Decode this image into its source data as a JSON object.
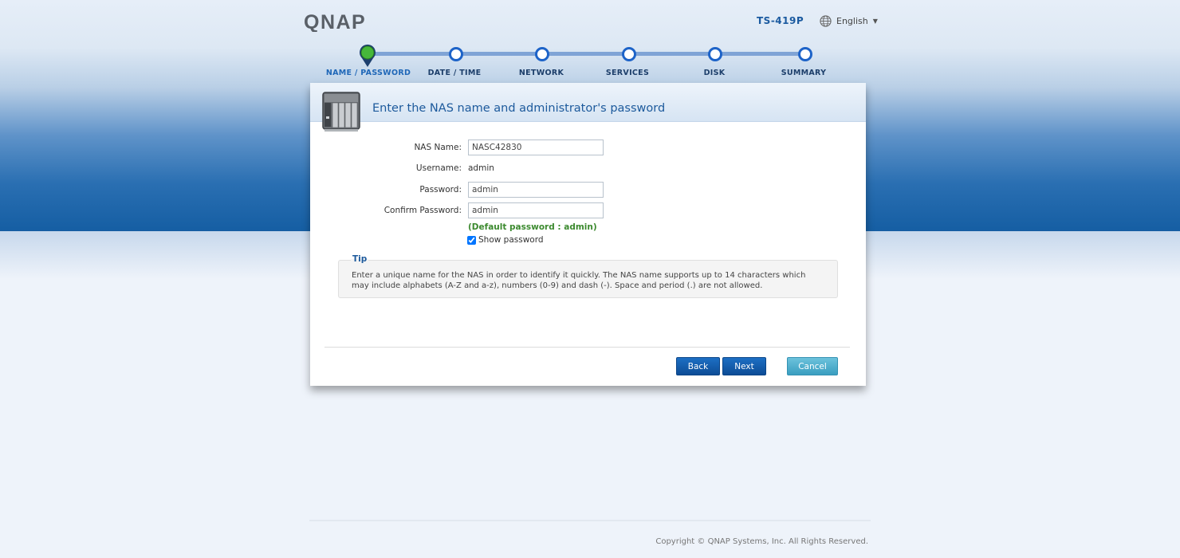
{
  "brand": {
    "logo": "QNAP",
    "model": "TS-419P"
  },
  "language": {
    "label": "English"
  },
  "steps": [
    {
      "label": "NAME / PASSWORD",
      "active": true
    },
    {
      "label": "DATE / TIME",
      "active": false
    },
    {
      "label": "NETWORK",
      "active": false
    },
    {
      "label": "SERVICES",
      "active": false
    },
    {
      "label": "DISK",
      "active": false
    },
    {
      "label": "SUMMARY",
      "active": false
    }
  ],
  "panel": {
    "title": "Enter the NAS name and administrator's password",
    "form": {
      "nas_name_label": "NAS Name:",
      "nas_name_value": "NASC42830",
      "username_label": "Username:",
      "username_value": "admin",
      "password_label": "Password:",
      "password_value": "admin",
      "confirm_label": "Confirm Password:",
      "confirm_value": "admin",
      "default_note": "(Default password : admin)",
      "show_password_label": "Show password",
      "show_password_checked": true
    },
    "tip": {
      "title": "Tip",
      "text": "Enter a unique name for the NAS in order to identify it quickly. The NAS name supports up to 14 characters which may include alphabets (A-Z and a-z), numbers (0-9) and dash (-). Space and period (.) are not allowed."
    },
    "buttons": {
      "back": "Back",
      "next": "Next",
      "cancel": "Cancel"
    }
  },
  "footer": {
    "copyright": "Copyright © QNAP Systems, Inc. All Rights Reserved."
  },
  "colors": {
    "accent": "#1d63c8",
    "step_active": "#3aa82a",
    "default_note": "#3c8a2f"
  }
}
